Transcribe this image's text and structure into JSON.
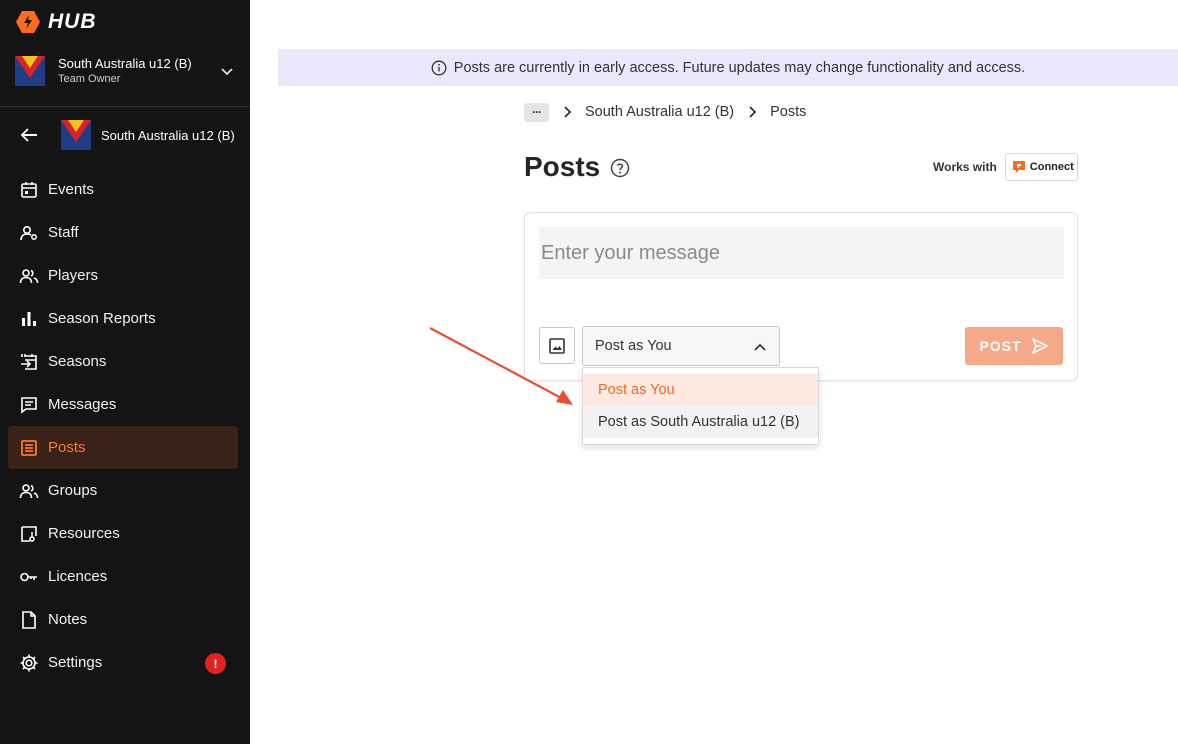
{
  "app": {
    "logo_text": "HUB"
  },
  "sidebar": {
    "team_switch": {
      "name": "South Australia u12 (B)",
      "role": "Team Owner"
    },
    "team_back": {
      "label": "South Australia u12 (B)"
    },
    "items": [
      {
        "label": "Events",
        "icon": "calendar-icon"
      },
      {
        "label": "Staff",
        "icon": "staff-icon"
      },
      {
        "label": "Players",
        "icon": "players-icon"
      },
      {
        "label": "Season Reports",
        "icon": "bar-chart-icon"
      },
      {
        "label": "Seasons",
        "icon": "seasons-icon"
      },
      {
        "label": "Messages",
        "icon": "message-icon"
      },
      {
        "label": "Posts",
        "icon": "posts-icon",
        "active": true
      },
      {
        "label": "Groups",
        "icon": "groups-icon"
      },
      {
        "label": "Resources",
        "icon": "resources-icon"
      },
      {
        "label": "Licences",
        "icon": "key-icon"
      },
      {
        "label": "Notes",
        "icon": "note-icon"
      },
      {
        "label": "Settings",
        "icon": "gear-icon",
        "badge": "!"
      }
    ]
  },
  "banner": {
    "text": "Posts are currently in early access. Future updates may change functionality and access."
  },
  "breadcrumb": {
    "more": "···",
    "team": "South Australia u12 (B)",
    "current": "Posts"
  },
  "page": {
    "title": "Posts",
    "works_with": "Works with",
    "connect_label": "Connect"
  },
  "composer": {
    "placeholder": "Enter your message",
    "select_value": "Post as You",
    "post_label": "POST",
    "options": [
      {
        "label": "Post as You",
        "selected": true
      },
      {
        "label": "Post as South Australia u12 (B)",
        "selected": false
      }
    ]
  },
  "colors": {
    "accent": "#ff7a2f",
    "sidebar_bg": "#141414",
    "banner_bg": "#eae8fb",
    "post_button": "#f6a988",
    "annotation_arrow": "#e8502e"
  }
}
